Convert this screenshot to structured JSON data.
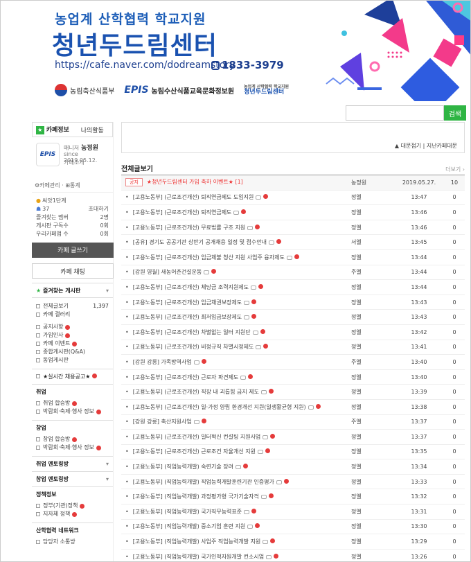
{
  "banner": {
    "subtitle": "농업계 산학협력 학교지원",
    "title": "청년두드림센터",
    "url": "https://cafe.naver.com/dodreamstory",
    "phone": "1833-3979",
    "logo_ministry": "농림축산식품부",
    "logo_epis": "EPIS",
    "logo_epis_name": "농림수산식품교육문화정보원",
    "logo_center_sub": "농업계 산학협력 학교지원",
    "logo_center": "청년두드림센터"
  },
  "search": {
    "placeholder": "",
    "button": "검색"
  },
  "sidebar": {
    "tab_info": "카페정보",
    "tab_activity": "나의활동",
    "avatar": "EPIS",
    "manager_label": "매니저",
    "manager_name": "농정원",
    "since": "since 2019.05.12.",
    "intro": "카페소개",
    "links": "⚙카페관리 · ⊞통계",
    "level": "씨앗1단계",
    "members": "37",
    "invite": "초대하기",
    "stats": [
      {
        "label": "즐겨찾는 멤버",
        "value": "2명"
      },
      {
        "label": "게시판 구독수",
        "value": "0회"
      },
      {
        "label": "우리카페앱 수",
        "value": "0회"
      }
    ],
    "write_button": "카페 글쓰기",
    "chat_button": "카페 채팅",
    "fav_label": "즐겨찾는 게시판",
    "all_posts": "전체글보기",
    "all_posts_count": "1,397",
    "gallery": "카페 갤러리",
    "menus1": [
      "공지사항",
      "가입인사",
      "카페 이벤트",
      "종합게시판(Q&A)",
      "동업게시판"
    ],
    "realtime": "★실시간 채용공고★",
    "sec_job": "취업",
    "job_items": [
      "취업 합승방",
      "박람회·축제·행사 정보"
    ],
    "sec_startup": "창업",
    "startup_items": [
      "창업 합승방",
      "박람회·축제·행사 정보"
    ],
    "sec_job_mentoring": "취업 멘토링방",
    "sec_startup_mentoring": "창업 멘토링방",
    "sec_policy": "정책정보",
    "policy_items": [
      "정부(기관)정책",
      "지자체 정책"
    ],
    "sec_network": "산학협력 네트워크",
    "network_items": [
      "담당자 소통방"
    ]
  },
  "cafeinfo": {
    "right_text": "▲ 대문접기 | 지난카페대문"
  },
  "board": {
    "title": "전체글보기",
    "more": "더보기 ›",
    "notice": {
      "badge": "공지",
      "subject": "★청년두드림센터 가입 축하 이벤트★ [1]",
      "author": "농정원",
      "date": "2019.05.27.",
      "views": "10"
    },
    "rows": [
      {
        "subject": "[고용노동부] (근로조건개선) 퇴직연금제도 도입지원",
        "author": "정엘",
        "date": "13:47",
        "views": "0"
      },
      {
        "subject": "[고용노동부] (근로조건개선) 퇴직연금제도",
        "author": "정엘",
        "date": "13:46",
        "views": "0"
      },
      {
        "subject": "[고용노동부] (근로조건개선) 무료법률 구조 지원",
        "author": "정엘",
        "date": "13:46",
        "views": "0"
      },
      {
        "subject": "[공유] 경기도 공공기관 상반기 공개채용 일정 및 접수안내",
        "author": "서엘",
        "date": "13:45",
        "views": "0"
      },
      {
        "subject": "[고용노동부] (근로조건개선) 임금체불 청산 지원 사업주 융자제도",
        "author": "정엘",
        "date": "13:44",
        "views": "0"
      },
      {
        "subject": "[강원 영월] 새농어촌건설운동",
        "author": "주엘",
        "date": "13:44",
        "views": "0"
      },
      {
        "subject": "[고용노동부] (근로조건개선) 체당금 조력지원제도",
        "author": "정엘",
        "date": "13:44",
        "views": "0"
      },
      {
        "subject": "[고용노동부] (근로조건개선) 임금채권보장제도",
        "author": "정엘",
        "date": "13:43",
        "views": "0"
      },
      {
        "subject": "[고용노동부] (근로조건개선) 최저임금보장제도",
        "author": "정엘",
        "date": "13:43",
        "views": "0"
      },
      {
        "subject": "[고용노동부] (근로조건개선) 차별없는 일터 지원단",
        "author": "정엘",
        "date": "13:42",
        "views": "0"
      },
      {
        "subject": "[고용노동부] (근로조건개선) 비정규직 차별시정제도",
        "author": "정엘",
        "date": "13:41",
        "views": "0"
      },
      {
        "subject": "[강원 강릉] 가족방역사업",
        "author": "주엘",
        "date": "13:40",
        "views": "0"
      },
      {
        "subject": "[고용노동부] (근로조건개선) 근로자 파견제도",
        "author": "정엘",
        "date": "13:40",
        "views": "0"
      },
      {
        "subject": "[고용노동부] (근로조건개선) 직장 내 괴롭힘 금지 제도",
        "author": "정엘",
        "date": "13:39",
        "views": "0"
      },
      {
        "subject": "[고용노동부] (근로조건개선) 일·가정 양립 환경개선 지원(일생활균형 지원)",
        "author": "정엘",
        "date": "13:38",
        "views": "0"
      },
      {
        "subject": "[강원 강릉] 축산지원사업",
        "author": "주엘",
        "date": "13:37",
        "views": "0"
      },
      {
        "subject": "[고용노동부] (근로조건개선) 일터혁신 컨설팅 지원사업",
        "author": "정엘",
        "date": "13:37",
        "views": "0"
      },
      {
        "subject": "[고용노동부] (근로조건개선) 근로조건 자율개선 지원",
        "author": "정엘",
        "date": "13:35",
        "views": "0"
      },
      {
        "subject": "[고용노동부] (직업능력개발) 숙련기술 장려",
        "author": "정엘",
        "date": "13:34",
        "views": "0"
      },
      {
        "subject": "[고용노동부] (직업능력개발) 직업능력개발훈련기관 인증평가",
        "author": "정엘",
        "date": "13:33",
        "views": "0"
      },
      {
        "subject": "[고용노동부] (직업능력개발) 과정평가형 국가기술자격",
        "author": "정엘",
        "date": "13:32",
        "views": "0"
      },
      {
        "subject": "[고용노동부] (직업능력개발) 국가직무능력표준",
        "author": "정엘",
        "date": "13:31",
        "views": "0"
      },
      {
        "subject": "[고용노동부] (직업능력개발) 중소기업 훈련 지원",
        "author": "정엘",
        "date": "13:30",
        "views": "0"
      },
      {
        "subject": "[고용노동부] (직업능력개발) 사업주 직업능력개발 지원",
        "author": "정엘",
        "date": "13:29",
        "views": "0"
      },
      {
        "subject": "[고용노동부] (직업능력개발) 국가인적자원개발 컨소시엄",
        "author": "정엘",
        "date": "13:26",
        "views": "0"
      }
    ]
  }
}
